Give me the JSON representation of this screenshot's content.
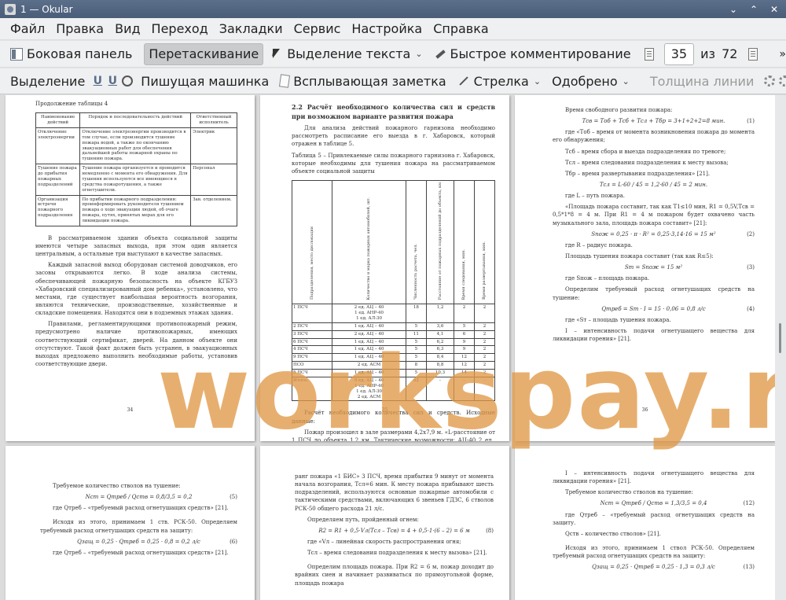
{
  "window": {
    "title": "1 — Okular",
    "minimize": "⌄",
    "maximize": "⌃",
    "close": "✕"
  },
  "menu": [
    "Файл",
    "Правка",
    "Вид",
    "Переход",
    "Закладки",
    "Сервис",
    "Настройка",
    "Справка"
  ],
  "toolbar1": {
    "sidebar": "Боковая панель",
    "drag": "Перетаскивание",
    "text_select": "Выделение текста",
    "quick_comment": "Быстрое комментирование",
    "page_current": "35",
    "page_of": "из",
    "page_total": "72"
  },
  "toolbar2": {
    "highlight": "Выделение",
    "typewriter": "Пишущая машинка",
    "popup_note": "Всплывающая заметка",
    "arrow": "Стрелка",
    "approved": "Одобрено",
    "line_width": "Толщина линии"
  },
  "watermark": "workspay.ru",
  "page34": {
    "heading": "Продолжение таблицы 4",
    "table_headers": [
      "Наименование действий",
      "Порядок и последовательность действий",
      "Ответственный исполнитель"
    ],
    "table_rows": [
      [
        "Отключение электроэнергии",
        "Отключение электроэнергии производится в том случае, если производится тушение пожара водой, а также по окончанию эвакуационных работ для обеспечения дальнейшей работы пожарной охраны по тушению пожара.",
        "Электрик"
      ],
      [
        "Тушение пожара до прибытия пожарных подразделений",
        "Тушение пожара организуется и проводится немедленно с момента его обнаружения. Для тушения используются все имеющиеся в средства пожаротушения, а также огнетушители.",
        "Персонал"
      ],
      [
        "Организация встречи пожарного подразделения",
        "По прибытии пожарного подразделения: проинформировать руководителя тушением пожара о ходе эвакуации людей, об очаге пожара, путях, принятых мерах для его ликвидации пожара.",
        "Зав. отделением."
      ]
    ],
    "p1": "В рассматриваемом здании объекта социальной защиты имеются четыре запасных выхода, при этом один является центральным, а остальные три выступают в качестве запасных.",
    "p2": "Каждый запасной выход оборудован системой доводчиков, его засовы открываются легко. В ходе анализа системы, обеспечивающей пожарную безопасность на объекте КГБУЗ «Хабаровский специализированный дом ребенка», установлено, что местами, где существует наибольшая вероятность возгорания, являются технические, производственные, хозяйственные и складские помещения. Находятся они в подземных этажах здания.",
    "p3": "Правилами, регламентирующими противопожарный режим, предусмотрено наличие противопожарных, имеющих соответствующий сертификат, дверей. На данном объекте они отсутствуют. Такой факт должен быть устранен, в эвакуационных выходах предложено выполнить необходимые работы, установив соответствующие двери.",
    "page_num": "34"
  },
  "page35": {
    "heading": "2.2 Расчёт необходимого количества сил и средств при возможном варианте развития пожара",
    "p1": "Для анализа действий пожарного гарнизона необходимо рассмотреть расписание его выезда в г. Хабаровск, который отражен в таблице 5.",
    "caption": "Таблица 5 – Привлекаемые силы пожарного гарнизона г. Хабаровск, которые необходимы для тушения пожара на рассматриваемом объекте социальной защиты",
    "table_headers": [
      "Подразделения, место дислокации",
      "Количество и марка пожарных автомобилей, шт.",
      "Численность расчета, чел.",
      "Расстояние от пожарных подразделений до объекта, км",
      "Время следования, мин.",
      "Время развертывания, мин."
    ],
    "table_rows": [
      [
        "1 ПСЧ",
        "2 ед. АЦ – 40\n1 ед. АНР-40\n1 ед. АЛ-30",
        "18",
        "1,2",
        "2",
        "2"
      ],
      [
        "2 ПСЧ",
        "1 ед. АЦ – 40",
        "5",
        "3,6",
        "5",
        "2"
      ],
      [
        "3 ПСЧ",
        "2 ед. АЦ – 40",
        "11",
        "4,1",
        "6",
        "2"
      ],
      [
        "6 ПСЧ",
        "1 ед. АЦ – 40",
        "5",
        "6,2",
        "9",
        "2"
      ],
      [
        "4 ПСЧ",
        "1 ед. АЦ – 40",
        "5",
        "6,3",
        "9",
        "2"
      ],
      [
        "9 ПСЧ",
        "1 ед. АЦ – 40",
        "5",
        "8,4",
        "12",
        "2"
      ],
      [
        "ПСО",
        "2 ед. АСМ",
        "8",
        "8,8",
        "12",
        "2"
      ],
      [
        "5 ПСЧ",
        "1 ед. АЦ – 40",
        "5",
        "10,3",
        "14",
        "2"
      ],
      [
        "Итого:",
        "9 ед. АЦ – 40\n1 ед. АНР-40\n1 ед. АЛ-30\n2 ед. АСМ",
        "62",
        "-",
        "-",
        "-"
      ]
    ],
    "p2": "Расчёт необходимого количества сил и средств. Исходные данные:",
    "p3": "Пожар произошел в зале размерами 4,2х7,9 м. «L-расстояние от 1 ПСЧ до объекта 1,2 км. Тактические возможности: АЦ-40 2 ед., АНР-40 1 ед. Vл=1 м/мин, Iт=0,06 л/м²с» [21]. Поскольку помещения рассматриваемого объекта имеют защиту сигнализацией, то пожар будет обнаружен в течение 2-х минут и развиваться будет согласно форме угла.",
    "page_num": "35"
  },
  "page36": {
    "p1": "Время свободного развития пожара:",
    "f1": "Tсв = Tоб + Tсб + Tсл + Tбр = 3+1+2+2=8 мин.",
    "f1_no": "(1)",
    "p2": "где «Tоб – время от момента возникновения пожара до момента его обнаружения;",
    "p3": "Tсб – время сбора и выезда подразделения по тревоге;",
    "p4": "Tсл – время следования подразделения к месту вызова;",
    "p5": "Tбр – время развертывания подразделения» [21].",
    "f2": "Tсл = L·60 / 45 = 1,2·60 / 45 = 2 мин.",
    "p6": "где L – путь пожара.",
    "p7": "«Площадь пожара составит, так как T1≤10 мин, R1 = 0,5V,Tсв = 0,5*1*8 = 4 м. При R1 = 4 м пожаром будет охвачено часть музыкального зала, площадь пожара составит» [21]:",
    "f3": "Sпож = 0,25 · π · R² = 0,25·3,14·16 = 15 м²",
    "f3_no": "(2)",
    "p8": "где R – радиус пожара.",
    "p9": "Площадь тушения пожара составит (так как R≤5):",
    "f4": "Sт = Sпож = 15 м²",
    "f4_no": "(3)",
    "p10": "где Sпож – площадь пожара.",
    "p11": "Определим требуемый расход огнетушащих средств на тушение:",
    "f5": "Qтреб = Sт · I = 15 · 0,06 = 0,8 л/с",
    "f5_no": "(4)",
    "p12": "где «Sт – площадь тушения пожара.",
    "p13": "I – интенсивность подачи огнетушащего вещества для ликвидации горения» [21].",
    "page_num": "36"
  },
  "page37": {
    "p1": "Требуемое количество стволов на тушение:",
    "f1": "Nст = Qтреб / Qств = 0,8/3,5 = 0,2",
    "f1_no": "(5)",
    "p2": "где Qтреб – «требуемый расход огнетушащих средств» [21].",
    "p3": "Исходя из этого, принимаем 1 ств. РСК-50. Определяем требуемый расход огнетушащих средств на защиту:",
    "f2": "Qзащ = 0,25 · Qтреб = 0,25 · 0,8 = 0,2 л/с",
    "f2_no": "(6)",
    "p4": "где Qтреб – «требуемый расход огнетушащих средств» [21]."
  },
  "page38": {
    "p1": "ранг пожара «1 БИС» 3 ПСЧ, время прибытия 9 минут от момента начала возгорания, Tсл=6 мин. К месту пожара прибывают шесть подразделений, используются основные пожарные автомобили с тактическими средствами, включающих 6 звеньев ГДЗС, 6 стволов РСК-50 общего расхода 21 л/с.",
    "p2": "Определяем путь, пройденный огнем:",
    "f1": "R2 = R1 + 0,5·Vл(Tсл – Tсв) = 4 + 0,5·1·(6 – 2) = 6 м",
    "f1_no": "(8)",
    "p3": "где «Vл – линейная скорость распространения огня;",
    "p4": "Tсл – время следования подразделения к месту вызова» [21].",
    "p5": "Определим площадь пожара. При R2 = 6 м, пожар доходит до врайних сиен и начинает развиваться по прямоугольной форме, площадь пожара"
  },
  "page39": {
    "p1": "I – интенсивность подачи огнетушащего вещества для ликвидации горения» [21].",
    "p2": "Требуемое количество стволов на тушение:",
    "f1": "Nст = Qтреб / Qств = 1,3/3,5 = 0,4",
    "f1_no": "(12)",
    "p3": "где Qтреб – «требуемый расход огнетушащих средств на защиту.",
    "p4": "Qств – количество стволов» [21].",
    "p5": "Исходя из этого, принимаем 1 ствол РСК-50. Определяем требуемый расход огнетушащих средств на защиту:",
    "f2": "Qзащ = 0,25 · Qтреб = 0,25 · 1,3 = 0,3 л/с",
    "f2_no": "(13)"
  }
}
